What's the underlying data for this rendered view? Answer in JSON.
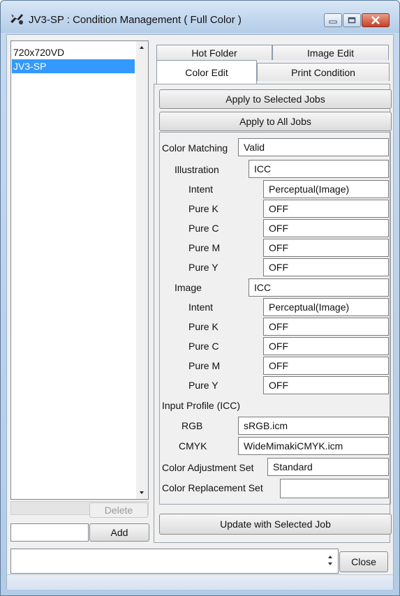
{
  "window": {
    "title": "JV3-SP : Condition Management ( Full Color )"
  },
  "conditions_list": {
    "items": [
      "720x720VD",
      "JV3-SP"
    ],
    "selected_index": 1
  },
  "buttons": {
    "delete": "Delete",
    "add": "Add",
    "apply_selected": "Apply to Selected Jobs",
    "apply_all": "Apply to All Jobs",
    "update_selected": "Update with Selected Job",
    "close": "Close"
  },
  "tabs": {
    "hot_folder": "Hot Folder",
    "image_edit": "Image Edit",
    "color_edit": "Color Edit",
    "print_condition": "Print Condition",
    "active": "Color Edit"
  },
  "properties": {
    "color_matching": {
      "label": "Color Matching",
      "value": "Valid"
    },
    "illustration": {
      "label": "Illustration",
      "value": "ICC",
      "intent": {
        "label": "Intent",
        "value": "Perceptual(Image)"
      },
      "pure_k": {
        "label": "Pure K",
        "value": "OFF"
      },
      "pure_c": {
        "label": "Pure C",
        "value": "OFF"
      },
      "pure_m": {
        "label": "Pure M",
        "value": "OFF"
      },
      "pure_y": {
        "label": "Pure Y",
        "value": "OFF"
      }
    },
    "image": {
      "label": "Image",
      "value": "ICC",
      "intent": {
        "label": "Intent",
        "value": "Perceptual(Image)"
      },
      "pure_k": {
        "label": "Pure K",
        "value": "OFF"
      },
      "pure_c": {
        "label": "Pure C",
        "value": "OFF"
      },
      "pure_m": {
        "label": "Pure M",
        "value": "OFF"
      },
      "pure_y": {
        "label": "Pure Y",
        "value": "OFF"
      }
    },
    "input_profile": {
      "label": "Input Profile (ICC)",
      "rgb": {
        "label": "RGB",
        "value": "sRGB.icm"
      },
      "cmyk": {
        "label": "CMYK",
        "value": "WideMimakiCMYK.icm"
      }
    },
    "color_adjustment_set": {
      "label": "Color Adjustment Set",
      "value": "Standard"
    },
    "color_replacement_set": {
      "label": "Color Replacement Set",
      "value": ""
    }
  },
  "colors": {
    "selection": "#3399ff",
    "titlebar": "#c3d7ee",
    "close_button": "#c6412a"
  }
}
